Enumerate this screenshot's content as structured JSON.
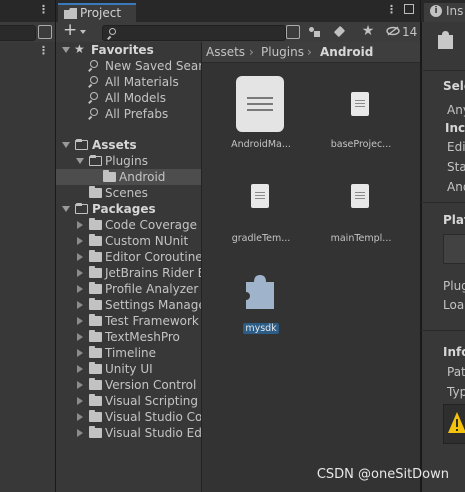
{
  "project_tab": {
    "label": "Project",
    "icon": "folder-icon"
  },
  "inspector_tab": {
    "label": "Ins",
    "icon": "info-icon"
  },
  "toolbar": {
    "add_label": "+",
    "hidden_count": "14",
    "search_placeholder": ""
  },
  "tree": {
    "favorites": {
      "label": "Favorites",
      "items": [
        "New Saved Sear",
        "All Materials",
        "All Models",
        "All Prefabs"
      ]
    },
    "assets": {
      "label": "Assets",
      "plugins": "Plugins",
      "android": "Android",
      "scenes": "Scenes"
    },
    "packages": {
      "label": "Packages",
      "items": [
        "Code Coverage",
        "Custom NUnit",
        "Editor Coroutines",
        "JetBrains Rider E",
        "Profile Analyzer",
        "Settings Manage",
        "Test Framework",
        "TextMeshPro",
        "Timeline",
        "Unity UI",
        "Version Control",
        "Visual Scripting",
        "Visual Studio Coo",
        "Visual Studio Edit"
      ]
    }
  },
  "breadcrumb": [
    "Assets",
    "Plugins",
    "Android"
  ],
  "assets_grid": [
    {
      "label": "AndroidMa...",
      "icon": "document-icon"
    },
    {
      "label": "baseProjec...",
      "icon": "document-icon"
    },
    {
      "label": "gradleTem...",
      "icon": "document-icon"
    },
    {
      "label": "mainTempl...",
      "icon": "document-icon"
    },
    {
      "label": "mysdk",
      "icon": "plugin-icon",
      "selected": true
    }
  ],
  "inspector": {
    "lines": [
      "Sele",
      "Any",
      "Incl",
      "Edit",
      "Sta",
      "And",
      "Plat",
      "Plug",
      "Loa",
      "Info",
      "Pat",
      "Typ"
    ]
  },
  "watermark": "CSDN @oneSitDown",
  "colors": {
    "accent": "#3a79bb",
    "selection": "#2c5d87",
    "warning": "#f4c20d"
  }
}
